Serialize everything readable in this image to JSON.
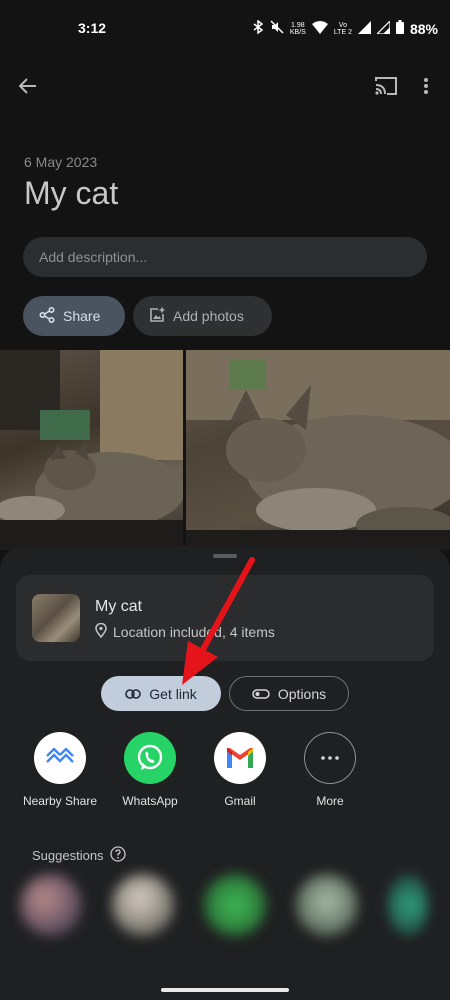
{
  "status_bar": {
    "time": "3:12",
    "net_speed_value": "1.98",
    "net_speed_unit": "KB/S",
    "lte_label_1": "Vo",
    "lte_label_2": "LTE 2",
    "battery": "88%"
  },
  "header": {
    "back_icon": "arrow-back-icon",
    "cast_icon": "cast-icon",
    "more_icon": "more-vert-icon"
  },
  "album": {
    "date": "6 May 2023",
    "title": "My cat",
    "description_placeholder": "Add description..."
  },
  "actions": {
    "share_label": "Share",
    "add_photos_label": "Add photos"
  },
  "photos": [
    {
      "name": "cat-photo-1"
    },
    {
      "name": "cat-photo-2"
    }
  ],
  "share_sheet": {
    "card": {
      "title": "My cat",
      "subtitle": "Location included, 4 items"
    },
    "get_link_label": "Get link",
    "options_label": "Options",
    "targets": [
      {
        "label": "Nearby Share",
        "icon": "nearby-share-icon",
        "color": "#ffffff"
      },
      {
        "label": "WhatsApp",
        "icon": "whatsapp-icon",
        "color": "#25d366"
      },
      {
        "label": "Gmail",
        "icon": "gmail-icon",
        "color": "#ffffff"
      },
      {
        "label": "More",
        "icon": "more-horiz-icon",
        "color": "#1f2021"
      }
    ],
    "suggestions_label": "Suggestions"
  },
  "colors": {
    "accent_red": "#e5141b",
    "get_link_bg": "#c2cddb",
    "share_chip_bg": "#4a5461"
  }
}
